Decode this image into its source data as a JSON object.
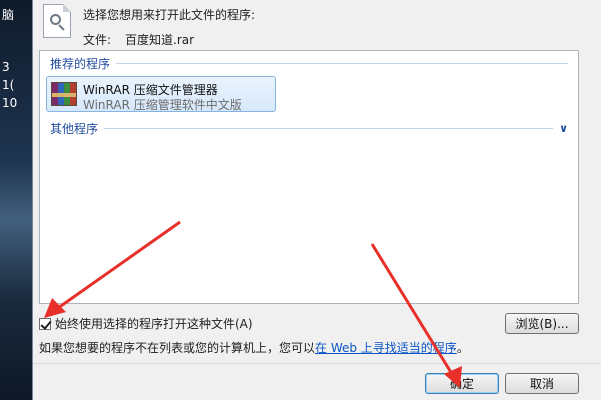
{
  "desktop": {
    "glyphs": [
      "脑",
      "3",
      "1(",
      "10"
    ]
  },
  "dialog": {
    "prompt": "选择您想用来打开此文件的程序:",
    "file_label": "文件:",
    "file_name": "百度知道.rar",
    "recommended_header": "推荐的程序",
    "recommended": [
      {
        "name": "WinRAR 压缩文件管理器",
        "desc": "WinRAR 压缩管理软件中文版",
        "icon": "winrar-icon"
      }
    ],
    "other_header": "其他程序",
    "always_use_label": "始终使用选择的程序打开这种文件(A)",
    "always_use_checked": true,
    "browse_label": "浏览(B)...",
    "info_text": "如果您想要的程序不在列表或您的计算机上，您可以",
    "info_link": "在 Web 上寻找适当的程序",
    "info_end": "。",
    "ok_label": "确定",
    "cancel_label": "取消"
  },
  "colors": {
    "annotation_arrow": "#e8302a",
    "link": "#0b55c4",
    "group_header": "#1e4a9a"
  }
}
